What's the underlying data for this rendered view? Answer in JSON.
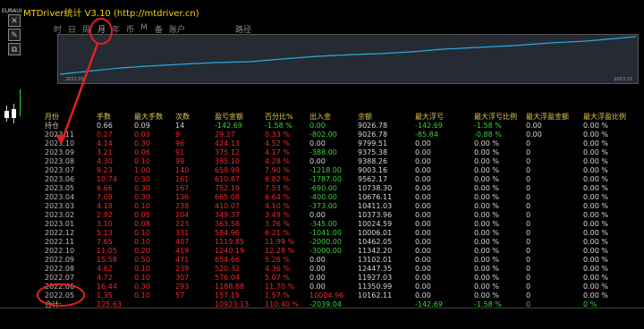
{
  "window": {
    "title": "MTDriver统计  V3.10 (http://mtdriver.cn)",
    "symbol": "EURAUD.m,..."
  },
  "side_buttons": [
    "✕",
    "✎",
    "⧉"
  ],
  "tabs": [
    "时",
    "日",
    "周",
    "月",
    "年",
    "币",
    "M",
    "备",
    "账户",
    "路径"
  ],
  "chart": {
    "start_label": "2022.05",
    "end_label": "2023.11",
    "line_color": "#2aa8e0"
  },
  "table": {
    "headers": [
      "月份",
      "手数",
      "最大手数",
      "次数",
      "盈亏金额",
      "百分比%",
      "出入金",
      "余额",
      "最大浮亏",
      "最大浮亏比例",
      "最大浮盈金额",
      "最大浮盈比例"
    ],
    "rows": [
      [
        "持仓",
        "0.66",
        "0.09",
        "14",
        "-142.69",
        "-1.58 %",
        "0.00",
        "9026.78",
        "-142.69",
        "-1.58 %",
        "0.00",
        "0.00 %"
      ],
      [
        "2023.11",
        "0.27",
        "0.03",
        "9",
        "29.27",
        "0.33 %",
        "-802.00",
        "9026.78",
        "-85.84",
        "-0.88 %",
        "0.00",
        "0.00 %"
      ],
      [
        "2023.10",
        "4.14",
        "0.30",
        "96",
        "424.13",
        "4.52 %",
        "0.00",
        "9799.51",
        "0.00",
        "0.00 %",
        "0",
        "0.00 %"
      ],
      [
        "2023.09",
        "3.21",
        "0.06",
        "91",
        "375.12",
        "4.17 %",
        "-388.00",
        "9375.38",
        "0.00",
        "0.00 %",
        "0",
        "0.00 %"
      ],
      [
        "2023.08",
        "4.30",
        "0.10",
        "99",
        "385.10",
        "4.28 %",
        "0.00",
        "9388.26",
        "0.00",
        "0.00 %",
        "0",
        "0.00 %"
      ],
      [
        "2023.07",
        "9.23",
        "1.00",
        "140",
        "658.99",
        "7.90 %",
        "-1218.00",
        "9003.16",
        "0.00",
        "0.00 %",
        "0",
        "0.00 %"
      ],
      [
        "2023.06",
        "10.74",
        "0.30",
        "161",
        "610.87",
        "6.82 %",
        "-1787.00",
        "9562.17",
        "0.00",
        "0.00 %",
        "0",
        "0.00 %"
      ],
      [
        "2023.05",
        "6.66",
        "0.30",
        "167",
        "752.19",
        "7.53 %",
        "-690.00",
        "10738.30",
        "0.00",
        "0.00 %",
        "0",
        "0.00 %"
      ],
      [
        "2023.04",
        "7.08",
        "0.30",
        "136",
        "665.08",
        "6.64 %",
        "-400.00",
        "10676.11",
        "0.00",
        "0.00 %",
        "0",
        "0.00 %"
      ],
      [
        "2023.03",
        "4.18",
        "0.10",
        "238",
        "410.07",
        "4.10 %",
        "-373.00",
        "10411.03",
        "0.00",
        "0.00 %",
        "0",
        "0.00 %"
      ],
      [
        "2023.02",
        "2.92",
        "0.05",
        "204",
        "349.37",
        "3.49 %",
        "0.00",
        "10373.96",
        "0.00",
        "0.00 %",
        "0",
        "0.00 %"
      ],
      [
        "2023.01",
        "3.10",
        "0.08",
        "223",
        "363.58",
        "3.76 %",
        "-345.00",
        "10024.59",
        "0.00",
        "0.00 %",
        "0",
        "0.00 %"
      ],
      [
        "2022.12",
        "5.13",
        "0.10",
        "331",
        "584.96",
        "6.21 %",
        "-1041.00",
        "10006.01",
        "0.00",
        "0.00 %",
        "0",
        "0.00 %"
      ],
      [
        "2022.11",
        "7.65",
        "0.10",
        "407",
        "1119.85",
        "11.99 %",
        "-2000.00",
        "10462.05",
        "0.00",
        "0.00 %",
        "0",
        "0.00 %"
      ],
      [
        "2022.10",
        "11.05",
        "0.20",
        "419",
        "1240.19",
        "12.28 %",
        "-3000.00",
        "11342.20",
        "0.00",
        "0.00 %",
        "0",
        "0.00 %"
      ],
      [
        "2022.09",
        "15.58",
        "0.50",
        "471",
        "654.66",
        "5.26 %",
        "0.00",
        "13102.01",
        "0.00",
        "0.00 %",
        "0",
        "0.00 %"
      ],
      [
        "2022.08",
        "4.62",
        "0.10",
        "239",
        "520.32",
        "4.36 %",
        "0.00",
        "12447.35",
        "0.00",
        "0.00 %",
        "0",
        "0.00 %"
      ],
      [
        "2022.07",
        "4.72",
        "0.10",
        "307",
        "576.04",
        "5.07 %",
        "0.00",
        "11927.03",
        "0.00",
        "0.00 %",
        "0",
        "0.00 %"
      ],
      [
        "2022.06",
        "16.44",
        "0.30",
        "293",
        "1188.88",
        "11.70 %",
        "0.00",
        "11350.99",
        "0.00",
        "0.00 %",
        "0",
        "0.00 %"
      ],
      [
        "2022.05",
        "1.35",
        "0.10",
        "57",
        "157.15",
        "1.57 %",
        "10004.96",
        "10162.11",
        "0.00",
        "0.00 %",
        "0",
        "0.00 %"
      ],
      [
        "合计:",
        "125.63",
        "",
        "",
        "10923.13",
        "110.40 %",
        "-2039.04",
        "",
        "-142.69",
        "-1.58 %",
        "0",
        "0 %"
      ]
    ]
  },
  "colors": {
    "accent": "#f5d000",
    "positive": "#ee2a2a",
    "negative": "#3bd13b",
    "annotation": "#e32020"
  }
}
